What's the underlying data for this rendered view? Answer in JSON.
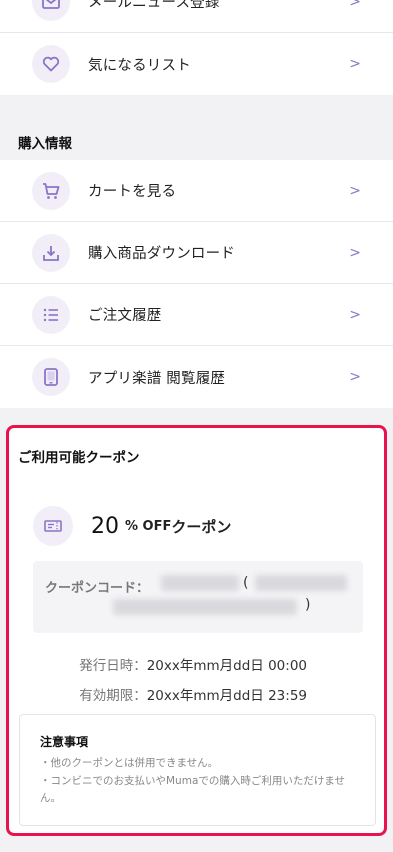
{
  "top_menu": {
    "items": [
      {
        "label": "メールニュース登録",
        "icon": "mail-icon"
      },
      {
        "label": "気になるリスト",
        "icon": "heart-icon"
      }
    ]
  },
  "purchase": {
    "section_title": "購入情報",
    "items": [
      {
        "label": "カートを見る",
        "icon": "cart-icon"
      },
      {
        "label": "購入商品ダウンロード",
        "icon": "download-icon"
      },
      {
        "label": "ご注文履歴",
        "icon": "list-icon"
      },
      {
        "label": "アプリ楽譜 閲覧履歴",
        "icon": "tablet-icon"
      }
    ],
    "chevron": ">"
  },
  "coupon": {
    "section_title": "ご利用可能クーポン",
    "icon": "ticket-icon",
    "value": "20",
    "unit": "% OFF",
    "suffix": "クーポン",
    "code_label": "クーポンコード：",
    "paren_open": "(",
    "paren_close": ")",
    "issue_label": "発行日時：",
    "issue_value": "20xx年mm月dd日 00:00",
    "expire_label": "有効期限：",
    "expire_value": "20xx年mm月dd日 23:59",
    "notes_title": "注意事項",
    "notes": [
      "・他のクーポンとは併用できません。",
      "・コンビニでのお支払いやMumaでの購入時ご利用いただけません。"
    ]
  },
  "colors": {
    "accent": "#8b74c9",
    "highlight_border": "#e8134e",
    "icon_bg": "#f1eef8"
  }
}
